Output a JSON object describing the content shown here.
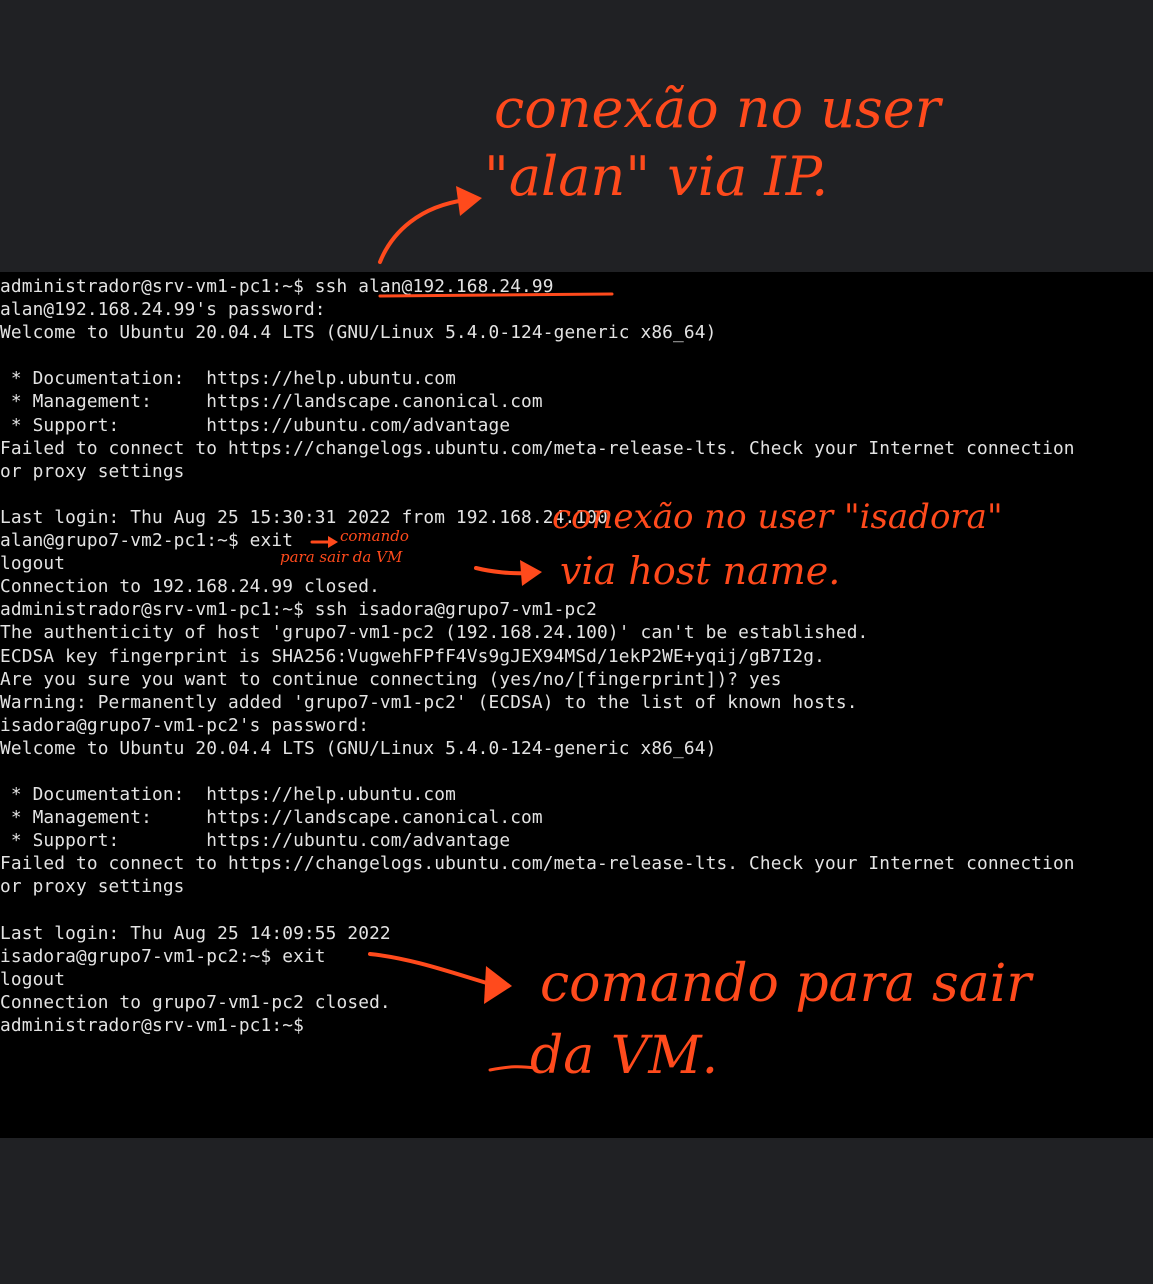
{
  "terminal": {
    "lines": [
      "administrador@srv-vm1-pc1:~$ ssh alan@192.168.24.99",
      "alan@192.168.24.99's password:",
      "Welcome to Ubuntu 20.04.4 LTS (GNU/Linux 5.4.0-124-generic x86_64)",
      "",
      " * Documentation:  https://help.ubuntu.com",
      " * Management:     https://landscape.canonical.com",
      " * Support:        https://ubuntu.com/advantage",
      "Failed to connect to https://changelogs.ubuntu.com/meta-release-lts. Check your Internet connection",
      "or proxy settings",
      "",
      "Last login: Thu Aug 25 15:30:31 2022 from 192.168.24.100",
      "alan@grupo7-vm2-pc1:~$ exit",
      "logout",
      "Connection to 192.168.24.99 closed.",
      "administrador@srv-vm1-pc1:~$ ssh isadora@grupo7-vm1-pc2",
      "The authenticity of host 'grupo7-vm1-pc2 (192.168.24.100)' can't be established.",
      "ECDSA key fingerprint is SHA256:VugwehFPfF4Vs9gJEX94MSd/1ekP2WE+yqij/gB7I2g.",
      "Are you sure you want to continue connecting (yes/no/[fingerprint])? yes",
      "Warning: Permanently added 'grupo7-vm1-pc2' (ECDSA) to the list of known hosts.",
      "isadora@grupo7-vm1-pc2's password:",
      "Welcome to Ubuntu 20.04.4 LTS (GNU/Linux 5.4.0-124-generic x86_64)",
      "",
      " * Documentation:  https://help.ubuntu.com",
      " * Management:     https://landscape.canonical.com",
      " * Support:        https://ubuntu.com/advantage",
      "Failed to connect to https://changelogs.ubuntu.com/meta-release-lts. Check your Internet connection",
      "or proxy settings",
      "",
      "Last login: Thu Aug 25 14:09:55 2022",
      "isadora@grupo7-vm1-pc2:~$ exit",
      "logout",
      "Connection to grupo7-vm1-pc2 closed.",
      "administrador@srv-vm1-pc1:~$"
    ]
  },
  "annotations": {
    "top_note_line1": "conexão no user",
    "top_note_line2": "\"alan\" via IP.",
    "exit_note_line1": "comando",
    "exit_note_line2": "para sair da VM",
    "middle_note_line1": "conexão no user \"isadora\"",
    "middle_note_line2": "via host name.",
    "bottom_note_line1": "comando para sair",
    "bottom_note_line2": "da VM."
  },
  "colors": {
    "page_background": "#202124",
    "terminal_background": "#000000",
    "terminal_text": "#e3e3e3",
    "annotation": "#ff4a1c"
  }
}
